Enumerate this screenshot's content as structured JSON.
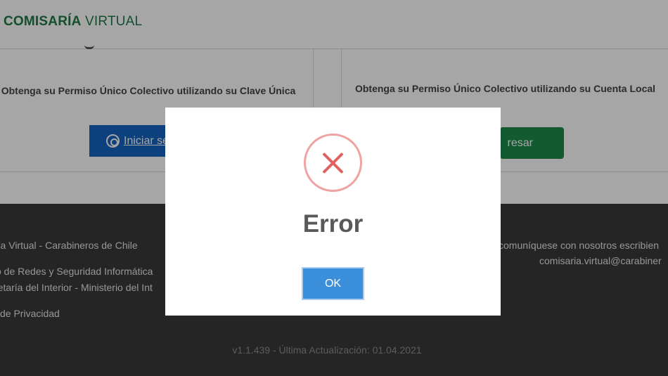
{
  "header": {
    "brand_bold": "COMISARÍA",
    "brand_light": " VIRTUAL"
  },
  "cards": {
    "left": {
      "text": "Obtenga su Permiso Único Colectivo utilizando su Clave Única",
      "button_label": "Iniciar se",
      "button_icon": "clave-unica-icon"
    },
    "right": {
      "text": "Obtenga su Permiso Único Colectivo utilizando su Cuenta Local",
      "button_label": "resar"
    }
  },
  "footer": {
    "left_lines": [
      "ría Virtual - Carabineros de Chile",
      "o de Redes y Seguridad Informática",
      "retaría del Interior - Ministerio del Int",
      "de Privacidad"
    ],
    "right_lines": [
      "comuníquese con nosotros escribien",
      "comisaria.virtual@carabiner"
    ],
    "version": "v1.1.439 - Última Actualización: 01.04.2021"
  },
  "modal": {
    "icon": "error-x-icon",
    "title": "Error",
    "ok_label": "OK"
  },
  "colors": {
    "brand_green": "#1f7a45",
    "login_blue": "#1565c0",
    "enter_green": "#1e8a4a",
    "footer_bg": "#3a3a3a",
    "error_red": "#e06060",
    "ok_blue": "#3b8ed9"
  }
}
